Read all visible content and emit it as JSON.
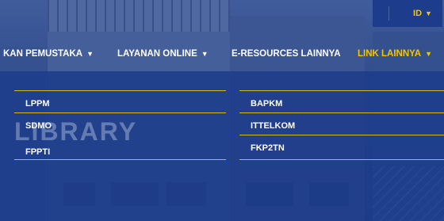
{
  "language_switcher": {
    "label": "ID"
  },
  "nav": {
    "items": [
      {
        "label": "KAN PEMUSTAKA"
      },
      {
        "label": "LAYANAN ONLINE"
      },
      {
        "label": "E-RESOURCES LAINNYA"
      },
      {
        "label": "LINK LAINNYA"
      }
    ]
  },
  "dropdown": {
    "left_column": [
      "LPPM",
      "SDMO",
      "FPPTI"
    ],
    "right_column": [
      "BAPKM",
      "ITTELKOM",
      "FKP2TN"
    ]
  },
  "watermark": {
    "text": "LIBRARY"
  },
  "colors": {
    "accent": "#f5c400",
    "nav_bg": "#1d3c8c",
    "dropdown_bg": "#1b3a8a"
  }
}
